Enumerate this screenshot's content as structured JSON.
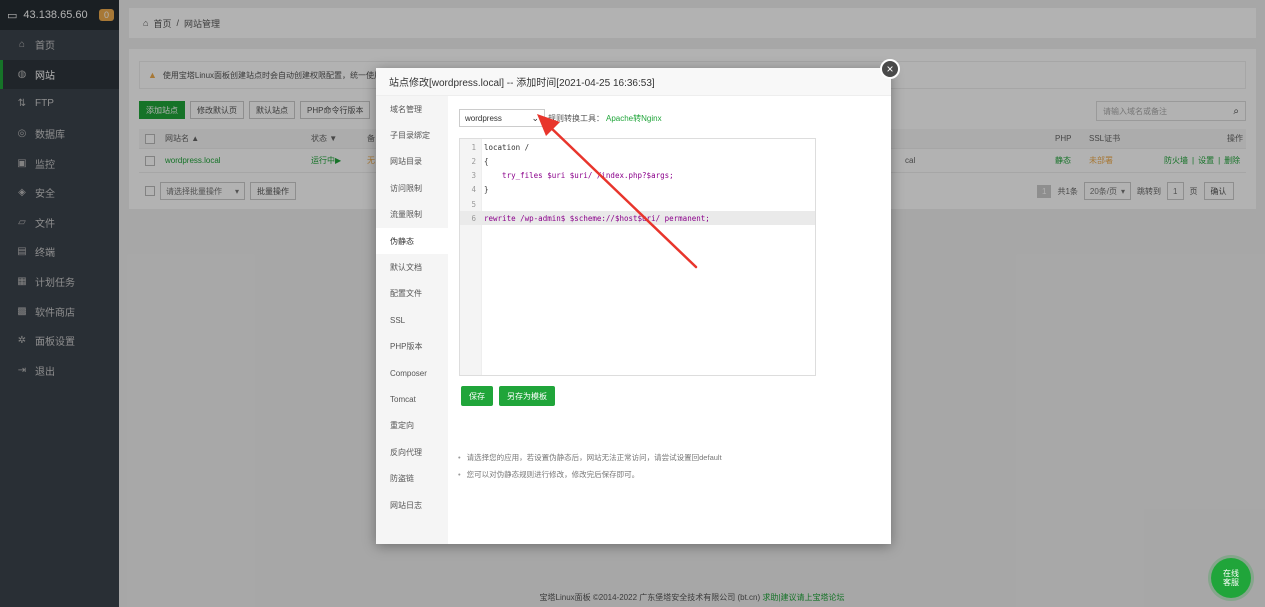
{
  "server": {
    "ip": "43.138.65.60",
    "badge": "0"
  },
  "sidebar": {
    "items": [
      {
        "label": "首页",
        "icon": "home-icon"
      },
      {
        "label": "网站",
        "icon": "globe-icon",
        "active": true
      },
      {
        "label": "FTP",
        "icon": "ftp-icon"
      },
      {
        "label": "数据库",
        "icon": "database-icon"
      },
      {
        "label": "监控",
        "icon": "monitor-icon"
      },
      {
        "label": "安全",
        "icon": "shield-icon"
      },
      {
        "label": "文件",
        "icon": "folder-icon"
      },
      {
        "label": "终端",
        "icon": "terminal-icon"
      },
      {
        "label": "计划任务",
        "icon": "calendar-icon"
      },
      {
        "label": "软件商店",
        "icon": "grid-icon"
      },
      {
        "label": "面板设置",
        "icon": "gear-icon"
      },
      {
        "label": "退出",
        "icon": "logout-icon"
      }
    ]
  },
  "breadcrumb": {
    "home": "首页",
    "sep": "/",
    "current": "网站管理"
  },
  "notice": "使用宝塔Linux面板创建站点时会自动创建权限配置，统一使用",
  "toolbar": {
    "buttons": [
      "添加站点",
      "修改默认页",
      "默认站点",
      "PHP命令行版本"
    ],
    "search_placeholder": "请输入域名或备注"
  },
  "table": {
    "headers": {
      "name": "网站名 ▲",
      "status": "状态 ▼",
      "backup": "备",
      "php": "PHP",
      "ssl": "SSL证书",
      "ops": "操作"
    },
    "row": {
      "name": "wordpress.local",
      "status": "运行中▶",
      "backup": "无",
      "path_tail": "cal",
      "php": "静态",
      "ssl": "未部署",
      "op_firewall": "防火墙",
      "op_settings": "设置",
      "op_delete": "删除",
      "sep": "|"
    }
  },
  "footer_bar": {
    "batch_placeholder": "请选择批量操作",
    "batch_button": "批量操作",
    "page": "1",
    "total": "共1条",
    "per_page": "20条/页",
    "jump_label": "跳转到",
    "jump_value": "1",
    "page_unit": "页",
    "confirm": "确认"
  },
  "copyright": {
    "text": "宝塔Linux面板 ©2014-2022 广东堡塔安全技术有限公司 (bt.cn)",
    "link": "求助|建议请上宝塔论坛"
  },
  "modal": {
    "title": "站点修改[wordpress.local] -- 添加时间[2021-04-25 16:36:53]",
    "close": "×",
    "nav": [
      "域名管理",
      "子目录绑定",
      "网站目录",
      "访问限制",
      "流量限制",
      "伪静态",
      "默认文档",
      "配置文件",
      "SSL",
      "PHP版本",
      "Composer",
      "Tomcat",
      "重定向",
      "反向代理",
      "防盗链",
      "网站日志"
    ],
    "active_nav": "伪静态",
    "template_select": "wordpress",
    "convert_label": "规则转换工具：",
    "convert_link": "Apache转Nginx",
    "code_lines": [
      {
        "n": "1",
        "text": "location /"
      },
      {
        "n": "2",
        "text": "{"
      },
      {
        "n": "3",
        "text": "    try_files $uri $uri/ /index.php?$args;"
      },
      {
        "n": "4",
        "text": "}"
      },
      {
        "n": "5",
        "text": ""
      },
      {
        "n": "6",
        "text": "rewrite /wp-admin$ $scheme://$host$uri/ permanent;"
      }
    ],
    "save_button": "保存",
    "save_template_button": "另存为模板",
    "tips": [
      "请选择您的应用，若设置伪静态后，网站无法正常访问，请尝试设置回default",
      "您可以对伪静态规则进行修改，修改完后保存即可。"
    ]
  },
  "chat": {
    "line1": "在线",
    "line2": "客服"
  },
  "colors": {
    "accent": "#20a53a",
    "sidebar": "#3c444d",
    "warning": "#f0ad4e",
    "arrow": "#e8352c"
  }
}
